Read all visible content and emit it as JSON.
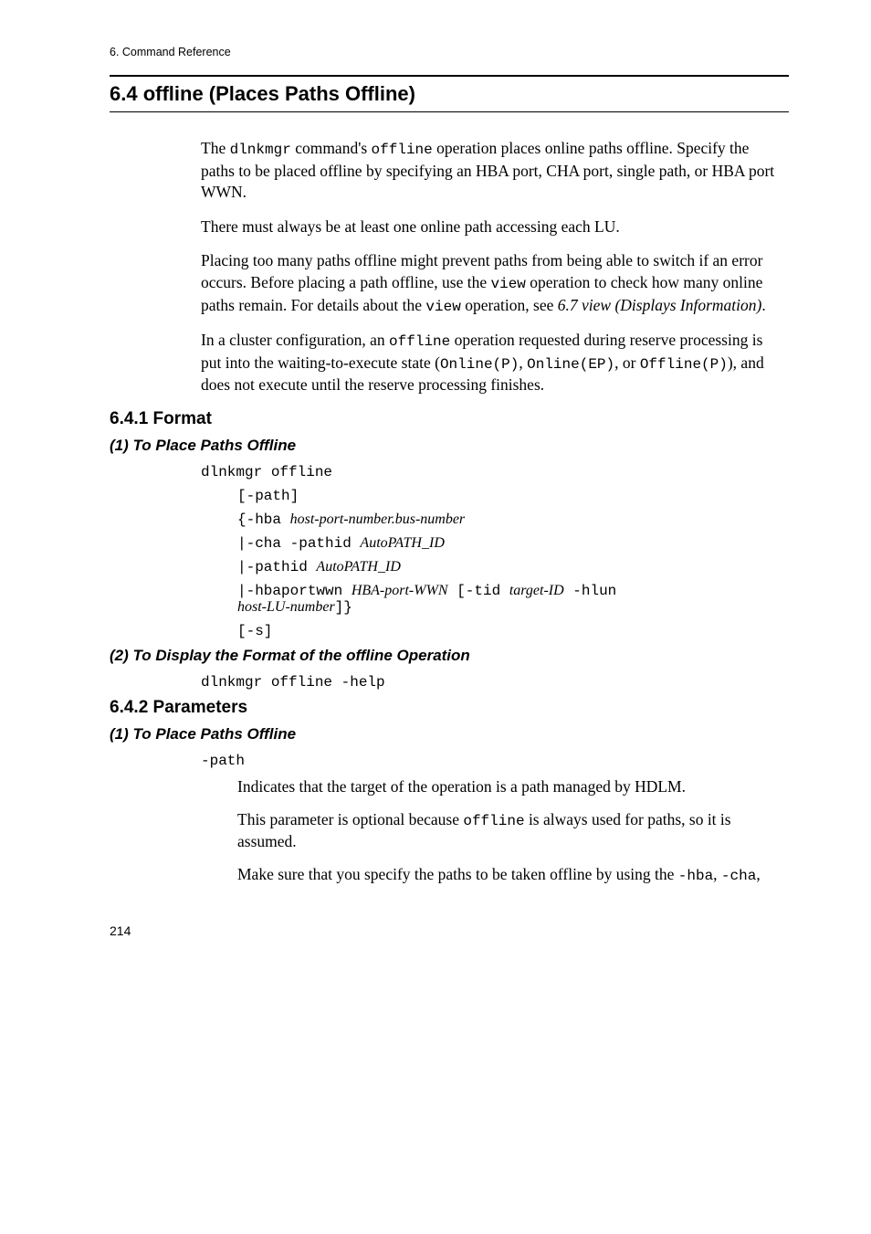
{
  "crumb": "6.  Command Reference",
  "h2": "6.4  offline (Places Paths Offline)",
  "intro": {
    "p1a": "The ",
    "p1b": "dlnkmgr",
    "p1c": " command's ",
    "p1d": "offline",
    "p1e": " operation places online paths offline. Specify the paths to be placed offline by specifying an HBA port, CHA port, single path, or HBA port WWN.",
    "p2": "There must always be at least one online path accessing each LU.",
    "p3a": "Placing too many paths offline might prevent paths from being able to switch if an error occurs. Before placing a path offline, use the ",
    "p3b": "view",
    "p3c": " operation to check how many online paths remain. For details about the ",
    "p3d": "view",
    "p3e": " operation, see ",
    "p3f": "6.7  view (Displays Information)",
    "p3g": ".",
    "p4a": "In a cluster configuration, an ",
    "p4b": "offline",
    "p4c": " operation requested during reserve processing is put into the waiting-to-execute state (",
    "p4d": "Online(P)",
    "p4e": ", ",
    "p4f": "Online(EP)",
    "p4g": ", or ",
    "p4h": "Offline(P)",
    "p4i": "), and does not execute until the reserve processing finishes."
  },
  "format": {
    "h3": "6.4.1  Format",
    "sub1": "(1)  To Place Paths Offline",
    "cmd1": "dlnkmgr offline",
    "line_path": "[-path]",
    "line_hba_a": "{-hba ",
    "line_hba_b": "host-port-number.bus-number",
    "line_cha_a": "|-cha -pathid ",
    "line_cha_b": "AutoPATH_ID",
    "line_pathid_a": "|-pathid ",
    "line_pathid_b": "AutoPATH_ID",
    "line_wwn_a": "|-hbaportwwn ",
    "line_wwn_b": "HBA-port-WWN",
    "line_wwn_c": " [-tid ",
    "line_wwn_d": "target-ID",
    "line_wwn_e": " -hlun ",
    "line_wwn_f": "host-LU-number",
    "line_wwn_g": "]}",
    "line_s": "[-s]",
    "sub2": "(2)  To Display the Format of the offline Operation",
    "cmd2": "dlnkmgr offline -help"
  },
  "params": {
    "h3": "6.4.2  Parameters",
    "sub1": "(1)  To Place Paths Offline",
    "term1": "-path",
    "d1": "Indicates that the target of the operation is a path managed by HDLM.",
    "d2a": "This parameter is optional because ",
    "d2b": "offline",
    "d2c": " is always used for paths, so it is assumed.",
    "d3a": "Make sure that you specify the paths to be taken offline by using the ",
    "d3b": "-hba",
    "d3c": ", ",
    "d3d": "-cha",
    "d3e": ","
  },
  "pagenum": "214"
}
